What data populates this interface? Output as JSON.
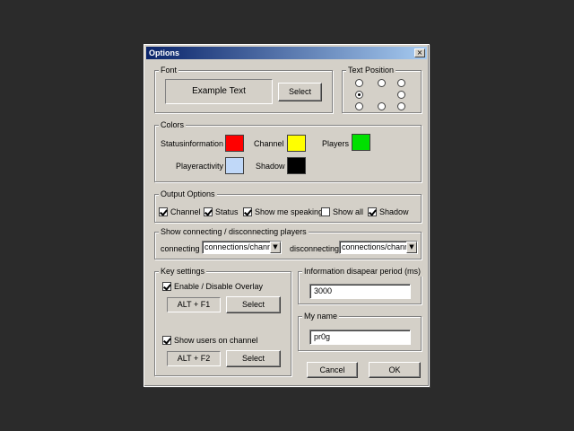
{
  "window": {
    "title": "Options",
    "close_glyph": "×"
  },
  "font": {
    "group_label": "Font",
    "example_text": "Example Text",
    "select_label": "Select"
  },
  "text_position": {
    "group_label": "Text Position",
    "selected": "middle-left"
  },
  "colors": {
    "group_label": "Colors",
    "items": [
      {
        "label": "Statusinformation",
        "color": "#ff0000"
      },
      {
        "label": "Channel",
        "color": "#ffff00"
      },
      {
        "label": "Players",
        "color": "#00e000"
      },
      {
        "label": "Playeractivity",
        "color": "#c0d8f8"
      },
      {
        "label": "Shadow",
        "color": "#000000"
      }
    ]
  },
  "output_options": {
    "group_label": "Output Options",
    "items": [
      {
        "label": "Channel",
        "checked": true
      },
      {
        "label": "Status",
        "checked": true
      },
      {
        "label": "Show me speaking",
        "checked": true
      },
      {
        "label": "Show all",
        "checked": false
      },
      {
        "label": "Shadow",
        "checked": true
      }
    ]
  },
  "connecting": {
    "group_label": "Show connecting / disconnecting players",
    "connecting_label": "connecting",
    "connecting_value": "connections/channel",
    "disconnecting_label": "disconnecting",
    "disconnecting_value": "connections/channel",
    "arrow_glyph": "▼"
  },
  "key_settings": {
    "group_label": "Key settings",
    "enable_overlay_label": "Enable / Disable Overlay",
    "enable_overlay_checked": true,
    "overlay_key": "ALT + F1",
    "overlay_select_label": "Select",
    "show_users_label": "Show users on channel",
    "show_users_checked": true,
    "users_key": "ALT + F2",
    "users_select_label": "Select"
  },
  "info_period": {
    "group_label": "Information disapear period (ms)",
    "value": "3000"
  },
  "my_name": {
    "group_label": "My name",
    "value": "pr0g"
  },
  "buttons": {
    "cancel_label": "Cancel",
    "ok_label": "OK"
  }
}
